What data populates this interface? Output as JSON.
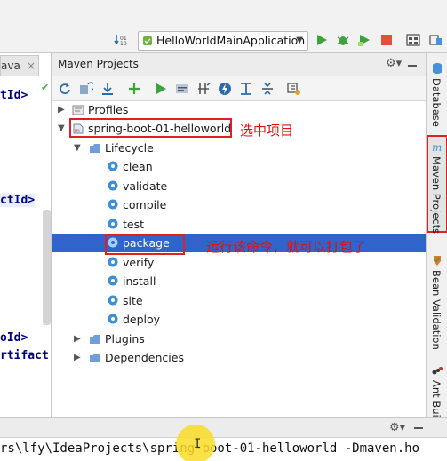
{
  "toolbar": {
    "run_config": "HelloWorldMainApplication",
    "icons": [
      "build-icon",
      "run-icon",
      "debug-icon",
      "coverage-icon",
      "stop-icon",
      "project-structure-icon",
      "sdk-icon"
    ]
  },
  "editor": {
    "tab_label": "ava",
    "tab_close": "×",
    "lines": [
      "tId>",
      "ctId>",
      "oId>",
      "rtifact"
    ]
  },
  "maven": {
    "title": "Maven Projects",
    "toolbar_icons": [
      "reimport-icon",
      "generate-sources-icon",
      "download-icon",
      "add-icon",
      "run-icon",
      "execute-goal-icon",
      "toggle-offline-icon",
      "skip-tests-icon",
      "show-dependencies-icon",
      "collapse-icon",
      "expand-icon",
      "settings-icon"
    ],
    "tree": {
      "profiles": "Profiles",
      "project": "spring-boot-01-helloworld",
      "lifecycle": "Lifecycle",
      "goals": [
        "clean",
        "validate",
        "compile",
        "test",
        "package",
        "verify",
        "install",
        "site",
        "deploy"
      ],
      "selected_goal": "package",
      "plugins": "Plugins",
      "dependencies": "Dependencies"
    },
    "annotations": {
      "select_project": "选中项目",
      "run_package": "运行该命令，就可以打包了"
    }
  },
  "sidebar": {
    "tabs": [
      "Database",
      "Maven Projects",
      "Bean Validation",
      "Ant Build"
    ]
  },
  "console": {
    "text": "rs\\lfy\\IdeaProjects\\spring-boot-01-helloworld -Dmaven.ho"
  },
  "colors": {
    "selection": "#2f65ca",
    "annotation": "#e02020",
    "run_green": "#3aa33a",
    "stop_red": "#e0513a"
  }
}
